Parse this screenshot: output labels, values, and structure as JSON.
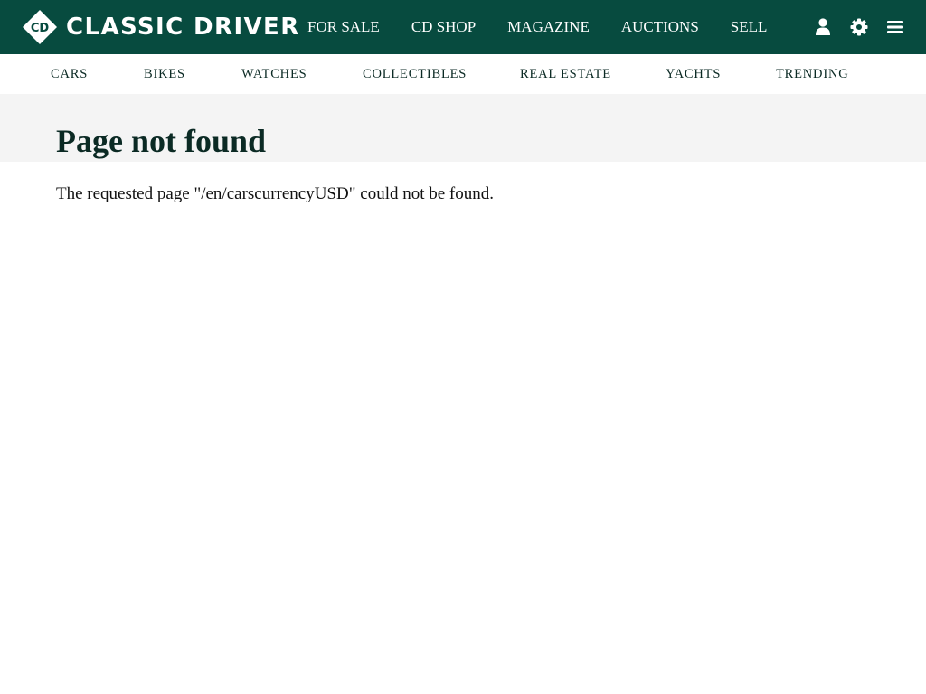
{
  "brand": {
    "logo_monogram": "CD",
    "name": "CLASSIC DRIVER",
    "color": "#074b3f"
  },
  "main_nav": [
    "FOR SALE",
    "CD SHOP",
    "MAGAZINE",
    "AUCTIONS",
    "SELL"
  ],
  "actions": {
    "account_icon": "user-icon",
    "settings_icon": "gear-icon",
    "menu_icon": "hamburger-menu-icon"
  },
  "sub_nav": [
    "CARS",
    "BIKES",
    "WATCHES",
    "COLLECTIBLES",
    "REAL ESTATE",
    "YACHTS",
    "TRENDING"
  ],
  "page": {
    "title": "Page not found",
    "message": "The requested page \"/en/carscurrencyUSD\" could not be found."
  }
}
